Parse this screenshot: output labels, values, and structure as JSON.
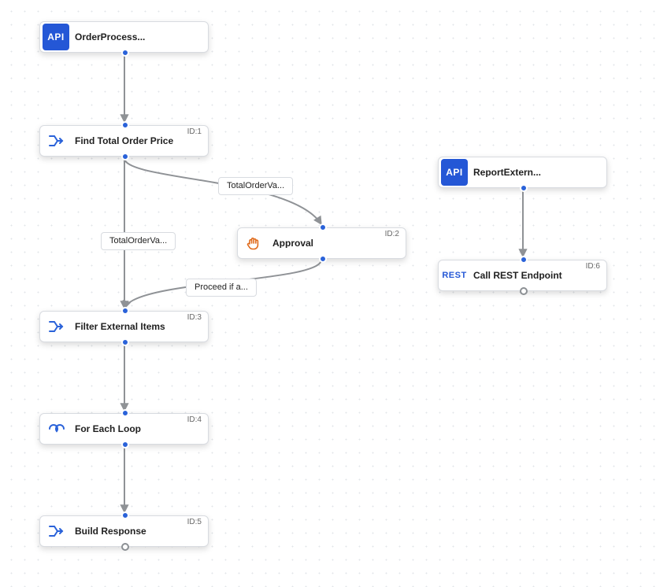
{
  "nodes": {
    "orderprocess": {
      "label": "OrderProcess...",
      "icon": "API",
      "icon_type": "api",
      "id": ""
    },
    "findtotal": {
      "label": "Find Total Order Price",
      "icon": "merge",
      "icon_type": "svg-merge",
      "id": "ID:1"
    },
    "approval": {
      "label": "Approval",
      "icon": "hand",
      "icon_type": "svg-hand",
      "id": "ID:2"
    },
    "filterext": {
      "label": "Filter External Items",
      "icon": "merge",
      "icon_type": "svg-merge",
      "id": "ID:3"
    },
    "foreach": {
      "label": "For Each Loop",
      "icon": "loop",
      "icon_type": "svg-loop",
      "id": "ID:4"
    },
    "buildresp": {
      "label": "Build Response",
      "icon": "merge",
      "icon_type": "svg-merge",
      "id": "ID:5"
    },
    "reportext": {
      "label": "ReportExtern...",
      "icon": "API",
      "icon_type": "api",
      "id": ""
    },
    "callrest": {
      "label": "Call REST Endpoint",
      "icon": "REST",
      "icon_type": "rest",
      "id": "ID:6"
    }
  },
  "edge_labels": {
    "total1": "TotalOrderVa...",
    "total2": "TotalOrderVa...",
    "proceed": "Proceed if a..."
  }
}
